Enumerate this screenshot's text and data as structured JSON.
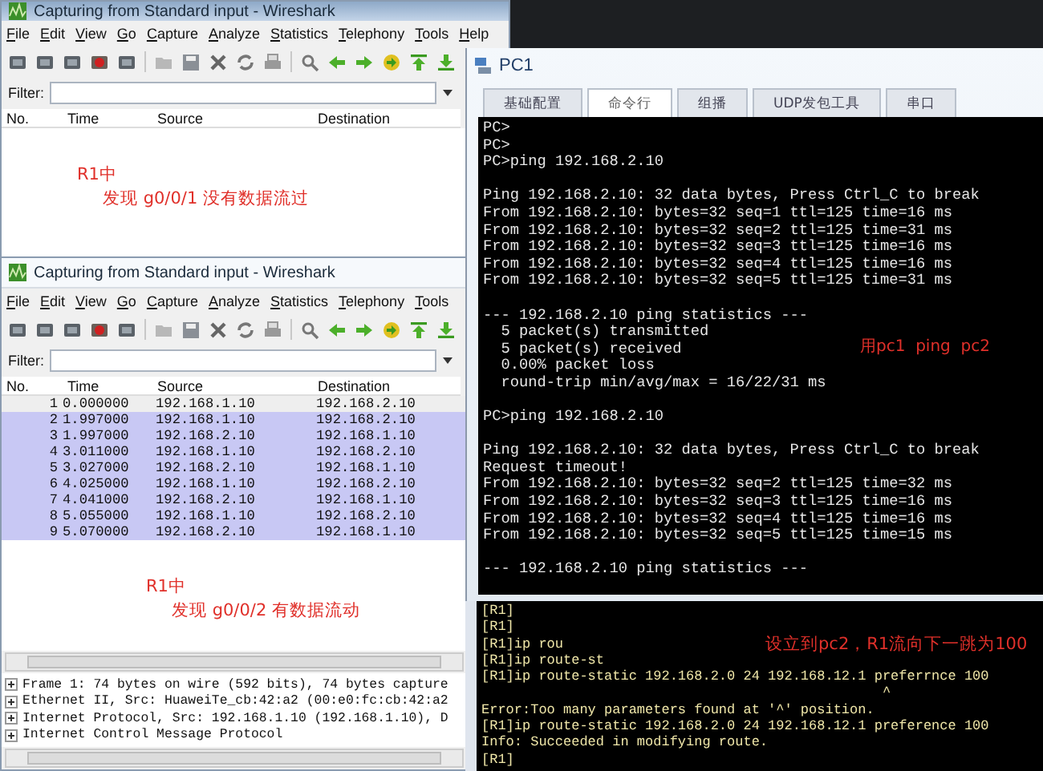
{
  "wireshark_top": {
    "title": "Capturing from Standard input - Wireshark",
    "menu": [
      "File",
      "Edit",
      "View",
      "Go",
      "Capture",
      "Analyze",
      "Statistics",
      "Telephony",
      "Tools",
      "Help"
    ],
    "filter_label": "Filter:",
    "columns": [
      "No.",
      "Time",
      "Source",
      "Destination"
    ],
    "note_lines": [
      "R1中",
      "发现 g0/0/1 没有数据流过"
    ]
  },
  "wireshark_bottom": {
    "title": "Capturing from Standard input - Wireshark",
    "menu": [
      "File",
      "Edit",
      "View",
      "Go",
      "Capture",
      "Analyze",
      "Statistics",
      "Telephony",
      "Tools"
    ],
    "filter_label": "Filter:",
    "columns": [
      "No.",
      "Time",
      "Source",
      "Destination"
    ],
    "rows": [
      {
        "no": "1",
        "time": "0.000000",
        "source": "192.168.1.10",
        "destination": "192.168.2.10",
        "selected": true
      },
      {
        "no": "2",
        "time": "1.997000",
        "source": "192.168.1.10",
        "destination": "192.168.2.10",
        "selected": false
      },
      {
        "no": "3",
        "time": "1.997000",
        "source": "192.168.2.10",
        "destination": "192.168.1.10",
        "selected": false
      },
      {
        "no": "4",
        "time": "3.011000",
        "source": "192.168.1.10",
        "destination": "192.168.2.10",
        "selected": false
      },
      {
        "no": "5",
        "time": "3.027000",
        "source": "192.168.2.10",
        "destination": "192.168.1.10",
        "selected": false
      },
      {
        "no": "6",
        "time": "4.025000",
        "source": "192.168.1.10",
        "destination": "192.168.2.10",
        "selected": false
      },
      {
        "no": "7",
        "time": "4.041000",
        "source": "192.168.2.10",
        "destination": "192.168.1.10",
        "selected": false
      },
      {
        "no": "8",
        "time": "5.055000",
        "source": "192.168.1.10",
        "destination": "192.168.2.10",
        "selected": false
      },
      {
        "no": "9",
        "time": "5.070000",
        "source": "192.168.2.10",
        "destination": "192.168.1.10",
        "selected": false
      }
    ],
    "note_lines": [
      "R1中",
      "发现 g0/0/2 有数据流动"
    ],
    "details": [
      {
        "text": "Frame 1: 74 bytes on wire (592 bits), 74 bytes capture",
        "expanded": false
      },
      {
        "text": "Ethernet II, Src: HuaweiTe_cb:42:a2 (00:e0:fc:cb:42:a2",
        "expanded": false
      },
      {
        "text": "Internet Protocol, Src: 192.168.1.10 (192.168.1.10), D",
        "expanded": false
      },
      {
        "text": "Internet Control Message Protocol",
        "expanded": false
      }
    ]
  },
  "pc1": {
    "title": "PC1",
    "tabs": [
      {
        "label": "基础配置",
        "selected": false
      },
      {
        "label": "命令行",
        "selected": true
      },
      {
        "label": "组播",
        "selected": false
      },
      {
        "label": "UDP发包工具",
        "selected": false
      },
      {
        "label": "串口",
        "selected": false
      }
    ],
    "blocks": [
      [
        "PC>",
        "PC>",
        "PC>ping 192.168.2.10"
      ],
      [
        "Ping 192.168.2.10: 32 data bytes, Press Ctrl_C to break",
        "From 192.168.2.10: bytes=32 seq=1 ttl=125 time=16 ms",
        "From 192.168.2.10: bytes=32 seq=2 ttl=125 time=31 ms",
        "From 192.168.2.10: bytes=32 seq=3 ttl=125 time=16 ms",
        "From 192.168.2.10: bytes=32 seq=4 ttl=125 time=16 ms",
        "From 192.168.2.10: bytes=32 seq=5 ttl=125 time=31 ms"
      ],
      [
        "--- 192.168.2.10 ping statistics ---",
        "  5 packet(s) transmitted",
        "  5 packet(s) received",
        "  0.00% packet loss",
        "  round-trip min/avg/max = 16/22/31 ms"
      ],
      [
        "PC>ping 192.168.2.10"
      ],
      [
        "Ping 192.168.2.10: 32 data bytes, Press Ctrl_C to break",
        "Request timeout!",
        "From 192.168.2.10: bytes=32 seq=2 ttl=125 time=32 ms",
        "From 192.168.2.10: bytes=32 seq=3 ttl=125 time=16 ms",
        "From 192.168.2.10: bytes=32 seq=4 ttl=125 time=16 ms",
        "From 192.168.2.10: bytes=32 seq=5 ttl=125 time=15 ms"
      ],
      [
        "--- 192.168.2.10 ping statistics ---"
      ]
    ],
    "note": "用pc1  ping  pc2"
  },
  "router_console": {
    "lines": [
      "[R1]",
      "[R1]",
      "[R1]ip rou",
      "[R1]ip route-st",
      "[R1]ip route-static 192.168.2.0 24 192.168.12.1 preferrnce 100",
      "                                                 ^",
      "Error:Too many parameters found at '^' position.",
      "[R1]ip route-static 192.168.2.0 24 192.168.12.1 preference 100",
      "Info: Succeeded in modifying route.",
      "[R1]"
    ],
    "note": "设立到pc2，R1流向下一跳为100"
  }
}
